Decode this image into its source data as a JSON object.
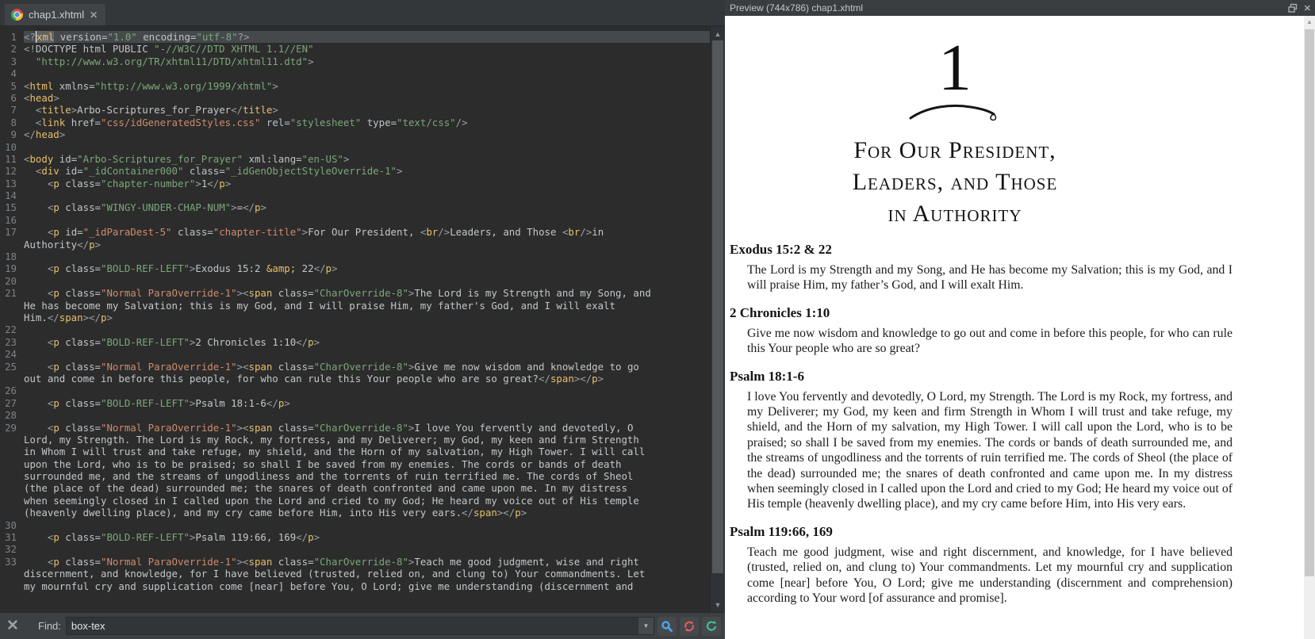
{
  "icons": {
    "close_x": "✕",
    "up": "▲",
    "down": "▼",
    "chrome_file": "chrome-logo",
    "magnifier_color": "#4da3e8",
    "refresh_red_color": "#e25d5d",
    "reset_green_color": "#3fbf8f"
  },
  "editor": {
    "tab": {
      "title": "chap1.xhtml"
    },
    "find": {
      "label": "Find:",
      "value": "box-tex"
    },
    "code_rows": [
      {
        "n": "1",
        "hl": 1,
        "t": [
          [
            "b",
            "<?"
          ],
          [
            "w",
            "xml"
          ],
          [
            "a",
            " version="
          ],
          [
            "s",
            "\"1.0\""
          ],
          [
            "a",
            " encoding="
          ],
          [
            "s",
            "\"utf-8\""
          ],
          [
            "b",
            "?>"
          ]
        ]
      },
      {
        "n": "2",
        "t": [
          [
            "b",
            "<!"
          ],
          [
            "a",
            "DOCTYPE html PUBLIC "
          ],
          [
            "s",
            "\"-//W3C//DTD XHTML 1.1//EN\""
          ]
        ]
      },
      {
        "n": "3",
        "t": [
          [
            "x",
            "  "
          ],
          [
            "s",
            "\"http://www.w3.org/TR/xhtml11/DTD/xhtml11.dtd\""
          ],
          [
            "b",
            ">"
          ]
        ]
      },
      {
        "n": "4",
        "t": []
      },
      {
        "n": "5",
        "t": [
          [
            "b",
            "<"
          ],
          [
            "t",
            "html"
          ],
          [
            "a",
            " xmlns="
          ],
          [
            "s",
            "\"http://www.w3.org/1999/xhtml\""
          ],
          [
            "b",
            ">"
          ]
        ]
      },
      {
        "n": "6",
        "t": [
          [
            "b",
            "<"
          ],
          [
            "t",
            "head"
          ],
          [
            "b",
            ">"
          ]
        ]
      },
      {
        "n": "7",
        "t": [
          [
            "x",
            "  "
          ],
          [
            "b",
            "<"
          ],
          [
            "t",
            "title"
          ],
          [
            "b",
            ">"
          ],
          [
            "x",
            "Arbo-Scriptures_for_Prayer"
          ],
          [
            "b",
            "</"
          ],
          [
            "t",
            "title"
          ],
          [
            "b",
            ">"
          ]
        ]
      },
      {
        "n": "8",
        "t": [
          [
            "x",
            "  "
          ],
          [
            "b",
            "<"
          ],
          [
            "t",
            "link"
          ],
          [
            "a",
            " href="
          ],
          [
            "sp",
            "\"css/idGeneratedStyles.css\""
          ],
          [
            "a",
            " rel="
          ],
          [
            "s",
            "\"stylesheet\""
          ],
          [
            "a",
            " type="
          ],
          [
            "s",
            "\"text/css\""
          ],
          [
            "b",
            "/>"
          ]
        ]
      },
      {
        "n": "9",
        "t": [
          [
            "b",
            "</"
          ],
          [
            "t",
            "head"
          ],
          [
            "b",
            ">"
          ]
        ]
      },
      {
        "n": "10",
        "t": []
      },
      {
        "n": "11",
        "t": [
          [
            "b",
            "<"
          ],
          [
            "t",
            "body"
          ],
          [
            "a",
            " id="
          ],
          [
            "s",
            "\"Arbo-Scriptures_for_Prayer\""
          ],
          [
            "a",
            " xml:lang="
          ],
          [
            "s",
            "\"en-US\""
          ],
          [
            "b",
            ">"
          ]
        ]
      },
      {
        "n": "12",
        "t": [
          [
            "x",
            "  "
          ],
          [
            "b",
            "<"
          ],
          [
            "t",
            "div"
          ],
          [
            "a",
            " id="
          ],
          [
            "s",
            "\"_idContainer000\""
          ],
          [
            "a",
            " class="
          ],
          [
            "s",
            "\"_idGenObjectStyleOverride-1\""
          ],
          [
            "b",
            ">"
          ]
        ]
      },
      {
        "n": "13",
        "t": [
          [
            "x",
            "    "
          ],
          [
            "b",
            "<"
          ],
          [
            "t",
            "p"
          ],
          [
            "a",
            " class="
          ],
          [
            "s",
            "\"chapter-number\""
          ],
          [
            "b",
            ">"
          ],
          [
            "x",
            "1"
          ],
          [
            "b",
            "</"
          ],
          [
            "t",
            "p"
          ],
          [
            "b",
            ">"
          ]
        ]
      },
      {
        "n": "14",
        "t": []
      },
      {
        "n": "15",
        "t": [
          [
            "x",
            "    "
          ],
          [
            "b",
            "<"
          ],
          [
            "t",
            "p"
          ],
          [
            "a",
            " class="
          ],
          [
            "s",
            "\"WINGY-UNDER-CHAP-NUM\""
          ],
          [
            "b",
            ">"
          ],
          [
            "x",
            "="
          ],
          [
            "b",
            "</"
          ],
          [
            "t",
            "p"
          ],
          [
            "b",
            ">"
          ]
        ]
      },
      {
        "n": "16",
        "t": []
      },
      {
        "n": "17",
        "t": [
          [
            "x",
            "    "
          ],
          [
            "b",
            "<"
          ],
          [
            "t",
            "p"
          ],
          [
            "a",
            " id="
          ],
          [
            "sp",
            "\"_idParaDest-5\""
          ],
          [
            "a",
            " class="
          ],
          [
            "sp",
            "\"chapter-title\""
          ],
          [
            "b",
            ">"
          ],
          [
            "x",
            "For Our President, "
          ],
          [
            "b",
            "<"
          ],
          [
            "t",
            "br"
          ],
          [
            "b",
            "/>"
          ],
          [
            "x",
            "Leaders, and Those "
          ],
          [
            "b",
            "<"
          ],
          [
            "t",
            "br"
          ],
          [
            "b",
            "/>"
          ],
          [
            "x",
            "in"
          ]
        ]
      },
      {
        "n": "",
        "t": [
          [
            "x",
            "Authority"
          ],
          [
            "b",
            "</"
          ],
          [
            "t",
            "p"
          ],
          [
            "b",
            ">"
          ]
        ]
      },
      {
        "n": "18",
        "t": []
      },
      {
        "n": "19",
        "t": [
          [
            "x",
            "    "
          ],
          [
            "b",
            "<"
          ],
          [
            "t",
            "p"
          ],
          [
            "a",
            " class="
          ],
          [
            "s",
            "\"BOLD-REF-LEFT\""
          ],
          [
            "b",
            ">"
          ],
          [
            "x",
            "Exodus 15:2 "
          ],
          [
            "e",
            "&amp;"
          ],
          [
            "x",
            " 22"
          ],
          [
            "b",
            "</"
          ],
          [
            "t",
            "p"
          ],
          [
            "b",
            ">"
          ]
        ]
      },
      {
        "n": "20",
        "t": []
      },
      {
        "n": "21",
        "t": [
          [
            "x",
            "    "
          ],
          [
            "b",
            "<"
          ],
          [
            "t",
            "p"
          ],
          [
            "a",
            " class="
          ],
          [
            "sp",
            "\"Normal ParaOverride-1\""
          ],
          [
            "b",
            "><"
          ],
          [
            "t",
            "span"
          ],
          [
            "a",
            " class="
          ],
          [
            "s",
            "\"CharOverride-8\""
          ],
          [
            "b",
            ">"
          ],
          [
            "x",
            "The Lord is my Strength and my Song, and"
          ]
        ]
      },
      {
        "n": "",
        "t": [
          [
            "x",
            "He has become my Salvation; this is my God, and I will praise Him, my father's God, and I will exalt"
          ]
        ]
      },
      {
        "n": "",
        "t": [
          [
            "x",
            "Him."
          ],
          [
            "b",
            "</"
          ],
          [
            "t",
            "span"
          ],
          [
            "b",
            "></"
          ],
          [
            "t",
            "p"
          ],
          [
            "b",
            ">"
          ]
        ]
      },
      {
        "n": "22",
        "t": []
      },
      {
        "n": "23",
        "t": [
          [
            "x",
            "    "
          ],
          [
            "b",
            "<"
          ],
          [
            "t",
            "p"
          ],
          [
            "a",
            " class="
          ],
          [
            "s",
            "\"BOLD-REF-LEFT\""
          ],
          [
            "b",
            ">"
          ],
          [
            "x",
            "2 Chronicles 1:10"
          ],
          [
            "b",
            "</"
          ],
          [
            "t",
            "p"
          ],
          [
            "b",
            ">"
          ]
        ]
      },
      {
        "n": "24",
        "t": []
      },
      {
        "n": "25",
        "t": [
          [
            "x",
            "    "
          ],
          [
            "b",
            "<"
          ],
          [
            "t",
            "p"
          ],
          [
            "a",
            " class="
          ],
          [
            "sp",
            "\"Normal ParaOverride-1\""
          ],
          [
            "b",
            "><"
          ],
          [
            "t",
            "span"
          ],
          [
            "a",
            " class="
          ],
          [
            "s",
            "\"CharOverride-8\""
          ],
          [
            "b",
            ">"
          ],
          [
            "x",
            "Give me now wisdom and knowledge to go"
          ]
        ]
      },
      {
        "n": "",
        "t": [
          [
            "x",
            "out and come in before this people, for who can rule this Your people who are so great?"
          ],
          [
            "b",
            "</"
          ],
          [
            "t",
            "span"
          ],
          [
            "b",
            "></"
          ],
          [
            "t",
            "p"
          ],
          [
            "b",
            ">"
          ]
        ]
      },
      {
        "n": "26",
        "t": []
      },
      {
        "n": "27",
        "t": [
          [
            "x",
            "    "
          ],
          [
            "b",
            "<"
          ],
          [
            "t",
            "p"
          ],
          [
            "a",
            " class="
          ],
          [
            "s",
            "\"BOLD-REF-LEFT\""
          ],
          [
            "b",
            ">"
          ],
          [
            "x",
            "Psalm 18:1-6"
          ],
          [
            "b",
            "</"
          ],
          [
            "t",
            "p"
          ],
          [
            "b",
            ">"
          ]
        ]
      },
      {
        "n": "28",
        "t": []
      },
      {
        "n": "29",
        "t": [
          [
            "x",
            "    "
          ],
          [
            "b",
            "<"
          ],
          [
            "t",
            "p"
          ],
          [
            "a",
            " class="
          ],
          [
            "sp",
            "\"Normal ParaOverride-1\""
          ],
          [
            "b",
            "><"
          ],
          [
            "t",
            "span"
          ],
          [
            "a",
            " class="
          ],
          [
            "s",
            "\"CharOverride-8\""
          ],
          [
            "b",
            ">"
          ],
          [
            "x",
            "I love You fervently and devotedly, O"
          ]
        ]
      },
      {
        "n": "",
        "t": [
          [
            "x",
            "Lord, my Strength. The Lord is my Rock, my fortress, and my Deliverer; my God, my keen and firm Strength"
          ]
        ]
      },
      {
        "n": "",
        "t": [
          [
            "x",
            "in Whom I will trust and take refuge, my shield, and the Horn of my salvation, my High Tower. I will call"
          ]
        ]
      },
      {
        "n": "",
        "t": [
          [
            "x",
            "upon the Lord, who is to be praised; so shall I be saved from my enemies. The cords or bands of death"
          ]
        ]
      },
      {
        "n": "",
        "t": [
          [
            "x",
            "surrounded me, and the streams of ungodliness and the torrents of ruin terrified me. The cords of Sheol"
          ]
        ]
      },
      {
        "n": "",
        "t": [
          [
            "x",
            "(the place of the dead) surrounded me; the snares of death confronted and came upon me. In my distress"
          ]
        ]
      },
      {
        "n": "",
        "t": [
          [
            "x",
            "when seemingly closed in I called upon the Lord and cried to my God; He heard my voice out of His temple"
          ]
        ]
      },
      {
        "n": "",
        "t": [
          [
            "x",
            "(heavenly dwelling place), and my cry came before Him, into His very ears."
          ],
          [
            "b",
            "</"
          ],
          [
            "t",
            "span"
          ],
          [
            "b",
            "></"
          ],
          [
            "t",
            "p"
          ],
          [
            "b",
            ">"
          ]
        ]
      },
      {
        "n": "30",
        "t": []
      },
      {
        "n": "31",
        "t": [
          [
            "x",
            "    "
          ],
          [
            "b",
            "<"
          ],
          [
            "t",
            "p"
          ],
          [
            "a",
            " class="
          ],
          [
            "s",
            "\"BOLD-REF-LEFT\""
          ],
          [
            "b",
            ">"
          ],
          [
            "x",
            "Psalm 119:66, 169"
          ],
          [
            "b",
            "</"
          ],
          [
            "t",
            "p"
          ],
          [
            "b",
            ">"
          ]
        ]
      },
      {
        "n": "32",
        "t": []
      },
      {
        "n": "33",
        "t": [
          [
            "x",
            "    "
          ],
          [
            "b",
            "<"
          ],
          [
            "t",
            "p"
          ],
          [
            "a",
            " class="
          ],
          [
            "sp",
            "\"Normal ParaOverride-1\""
          ],
          [
            "b",
            "><"
          ],
          [
            "t",
            "span"
          ],
          [
            "a",
            " class="
          ],
          [
            "s",
            "\"CharOverride-8\""
          ],
          [
            "b",
            ">"
          ],
          [
            "x",
            "Teach me good judgment, wise and right"
          ]
        ]
      },
      {
        "n": "",
        "t": [
          [
            "x",
            "discernment, and knowledge, for I have believed (trusted, relied on, and clung to) Your commandments. Let"
          ]
        ]
      },
      {
        "n": "",
        "t": [
          [
            "x",
            "my mournful cry and supplication come [near] before You, O Lord; give me understanding (discernment and"
          ]
        ]
      }
    ]
  },
  "preview": {
    "header": {
      "title": "Preview (744x786) chap1.xhtml"
    },
    "chapter_number": "1",
    "title_lines": [
      "For Our President,",
      "Leaders, and Those",
      "in Authority"
    ],
    "sections": [
      {
        "ref": "Exodus 15:2 & 22",
        "text": "The Lord is my Strength and my Song, and He has become my Salvation; this is my God, and I will praise Him, my father’s God, and I will exalt Him."
      },
      {
        "ref": "2 Chronicles 1:10",
        "text": "Give me now wisdom and knowledge to go out and come in before this people, for who can rule this Your people who are so great?"
      },
      {
        "ref": "Psalm 18:1-6",
        "text": "I love You fervently and devotedly, O Lord, my Strength. The Lord is my Rock, my fortress, and my Deliverer; my God, my keen and firm Strength in Whom I will trust and take refuge, my shield, and the Horn of my salvation, my High Tower. I will call upon the Lord, who is to be praised; so shall I be saved from my enemies. The cords or bands of death surrounded me, and the streams of ungodliness and the torrents of ruin terrified me. The cords of Sheol (the place of the dead) surrounded me; the snares of death confronted and came upon me. In my distress when seemingly closed in I called upon the Lord and cried to my God; He heard my voice out of His temple (heavenly dwelling place), and my cry came before Him, into His very ears."
      },
      {
        "ref": "Psalm 119:66, 169",
        "text": "Teach me good judgment, wise and right discernment, and knowledge, for I have believed (trusted, relied on, and clung to) Your commandments. Let my mournful cry and supplication come [near] before You, O Lord; give me understanding (discernment and comprehension) according to Your word [of assurance and promise]."
      }
    ]
  },
  "colors": {
    "editor_bg": "#2c2c2c",
    "tag": "#e8bf6a",
    "string": "#7ba779",
    "string_ref": "#cf8b6d",
    "text": "#c2c7ca",
    "chrome_bar": "#3c4043"
  }
}
